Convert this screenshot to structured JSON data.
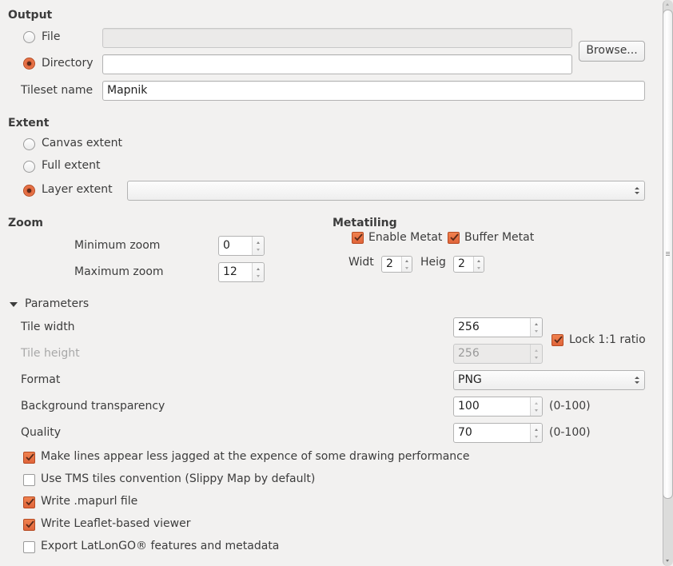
{
  "output": {
    "title": "Output",
    "file_label": "File",
    "file_value": "",
    "file_selected": false,
    "directory_label": "Directory",
    "directory_value": "",
    "directory_selected": true,
    "browse_label": "Browse...",
    "tileset_label": "Tileset name",
    "tileset_value": "Mapnik"
  },
  "extent": {
    "title": "Extent",
    "options": [
      {
        "label": "Canvas extent",
        "selected": false
      },
      {
        "label": "Full extent",
        "selected": false
      },
      {
        "label": "Layer extent",
        "selected": true
      }
    ],
    "layer_value": ""
  },
  "zoom": {
    "title": "Zoom",
    "min_label": "Minimum zoom",
    "min_value": "0",
    "max_label": "Maximum zoom",
    "max_value": "12"
  },
  "metatiling": {
    "title": "Metatiling",
    "enable_label": "Enable Metat",
    "enable_checked": true,
    "buffer_label": "Buffer Metat",
    "buffer_checked": true,
    "width_label": "Widt",
    "width_value": "2",
    "height_label": "Heig",
    "height_value": "2"
  },
  "parameters": {
    "title": "Parameters",
    "tile_width_label": "Tile width",
    "tile_width_value": "256",
    "tile_height_label": "Tile height",
    "tile_height_value": "256",
    "lock_label": "Lock 1:1 ratio",
    "lock_checked": true,
    "format_label": "Format",
    "format_value": "PNG",
    "bg_label": "Background transparency",
    "bg_value": "100",
    "bg_range": "(0-100)",
    "quality_label": "Quality",
    "quality_value": "70",
    "quality_range": "(0-100)"
  },
  "options": [
    {
      "label": "Make lines appear less jagged at the expence of some drawing performance",
      "checked": true
    },
    {
      "label": "Use TMS tiles convention (Slippy Map by default)",
      "checked": false
    },
    {
      "label": "Write .mapurl file",
      "checked": true
    },
    {
      "label": "Write Leaflet-based viewer",
      "checked": true
    },
    {
      "label": "Export LatLonGO® features and metadata",
      "checked": false
    }
  ],
  "colors": {
    "accent": "#e0643a",
    "background": "#f2f1f0",
    "text": "#3c3c3c",
    "disabled_text": "#a8a8a8"
  }
}
